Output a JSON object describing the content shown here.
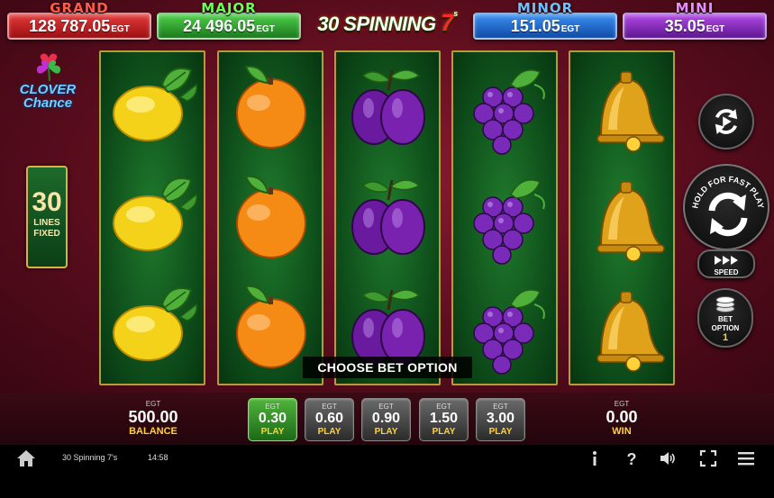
{
  "jackpots": {
    "grand": {
      "name": "GRAND",
      "value": "128 787.05",
      "currency": "EGT"
    },
    "major": {
      "name": "MAJOR",
      "value": "24 496.05",
      "currency": "EGT"
    },
    "minor": {
      "name": "MINOR",
      "value": "151.05",
      "currency": "EGT"
    },
    "mini": {
      "name": "MINI",
      "value": "35.05",
      "currency": "EGT"
    }
  },
  "title": {
    "text": "30 SPINNING",
    "seven": "7",
    "suffix": "s"
  },
  "logo": {
    "line1": "CLOVER",
    "line2": "Chance"
  },
  "lines": {
    "number": "30",
    "label1": "LINES",
    "label2": "FIXED"
  },
  "reels": [
    {
      "symbols": [
        "lemon",
        "lemon",
        "lemon"
      ]
    },
    {
      "symbols": [
        "orange",
        "orange",
        "orange"
      ]
    },
    {
      "symbols": [
        "plum",
        "plum",
        "plum"
      ]
    },
    {
      "symbols": [
        "grapes",
        "grapes",
        "grapes"
      ]
    },
    {
      "symbols": [
        "bell",
        "bell",
        "bell"
      ]
    }
  ],
  "controls": {
    "spin_arc_text": "HOLD FOR FAST PLAY",
    "speed_label": "SPEED",
    "bet_option_label1": "BET",
    "bet_option_label2": "OPTION",
    "bet_option_value": "1"
  },
  "choose_bet": "CHOOSE BET OPTION",
  "balance": {
    "currency": "EGT",
    "value": "500.00",
    "label": "BALANCE"
  },
  "win": {
    "currency": "EGT",
    "value": "0.00",
    "label": "WIN"
  },
  "bets": [
    {
      "currency": "EGT",
      "amount": "0.30",
      "label": "PLAY",
      "active": true
    },
    {
      "currency": "EGT",
      "amount": "0.60",
      "label": "PLAY",
      "active": false
    },
    {
      "currency": "EGT",
      "amount": "0.90",
      "label": "PLAY",
      "active": false
    },
    {
      "currency": "EGT",
      "amount": "1.50",
      "label": "PLAY",
      "active": false
    },
    {
      "currency": "EGT",
      "amount": "3.00",
      "label": "PLAY",
      "active": false
    }
  ],
  "footer": {
    "game_name": "30 Spinning 7's",
    "time": "14:58",
    "icons": [
      "home-icon",
      "info-icon",
      "help-icon",
      "sound-icon",
      "fullscreen-icon",
      "menu-icon"
    ]
  }
}
